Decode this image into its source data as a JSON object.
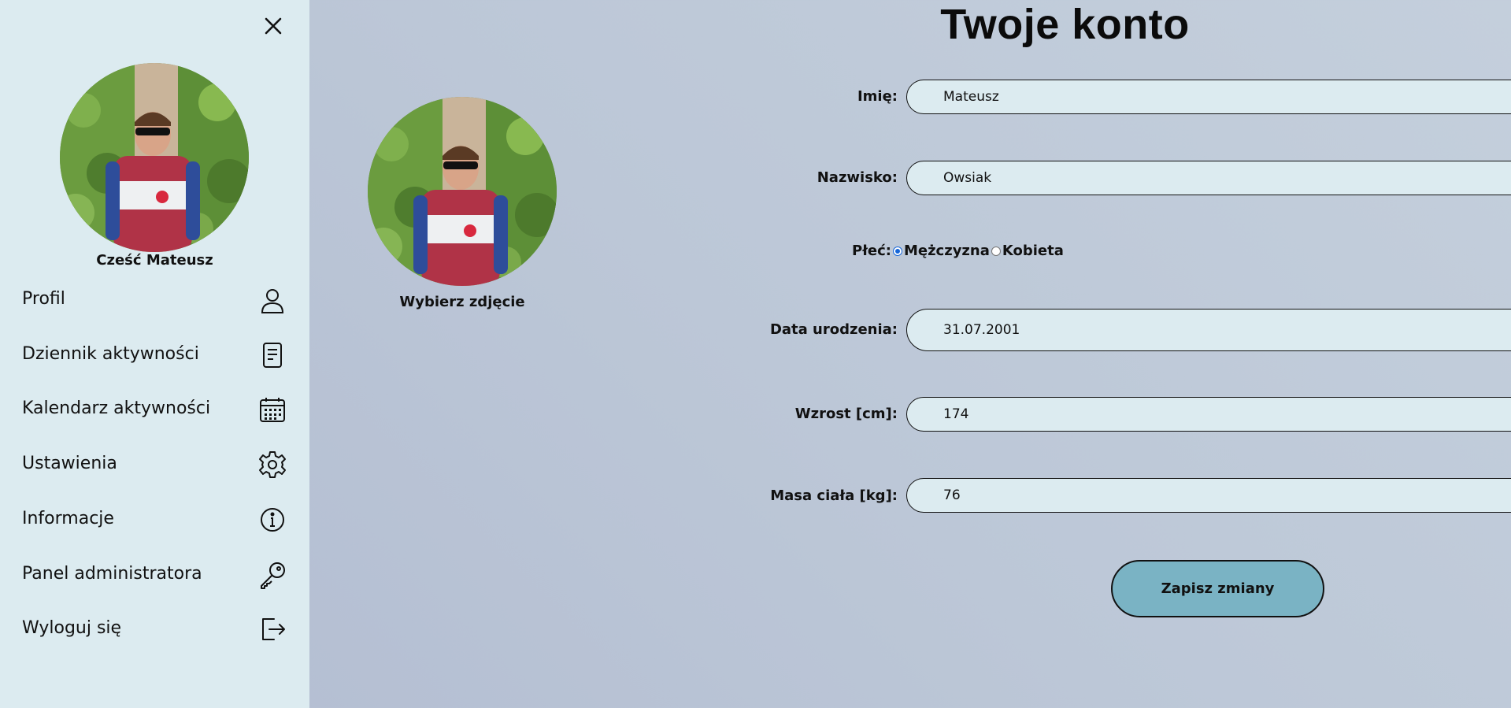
{
  "sidebar": {
    "greeting": "Cześć Mateusz",
    "items": [
      {
        "label": "Profil",
        "icon": "user-icon"
      },
      {
        "label": "Dziennik aktywności",
        "icon": "document-icon"
      },
      {
        "label": "Kalendarz aktywności",
        "icon": "calendar-icon"
      },
      {
        "label": "Ustawienia",
        "icon": "gear-icon"
      },
      {
        "label": "Informacje",
        "icon": "info-icon"
      },
      {
        "label": "Panel administratora",
        "icon": "key-icon"
      },
      {
        "label": "Wyloguj się",
        "icon": "logout-icon"
      }
    ]
  },
  "main": {
    "title": "Twoje konto",
    "choose_photo": "Wybierz zdjęcie",
    "fields": {
      "first_name": {
        "label": "Imię:",
        "value": "Mateusz"
      },
      "last_name": {
        "label": "Nazwisko:",
        "value": "Owsiak"
      },
      "gender": {
        "label": "Płeć:",
        "options": [
          "Mężczyzna",
          "Kobieta"
        ],
        "selected": "Mężczyzna"
      },
      "birth_date": {
        "label": "Data urodzenia:",
        "value": "31.07.2001"
      },
      "height": {
        "label": "Wzrost [cm]:",
        "value": "174"
      },
      "weight": {
        "label": "Masa ciała [kg]:",
        "value": "76"
      }
    },
    "save_label": "Zapisz zmiany"
  },
  "colors": {
    "sidebar_bg": "#dcebf0",
    "input_bg": "#dcebf0",
    "button_bg": "#7ab3c4",
    "radio_accent": "#1565d8"
  }
}
